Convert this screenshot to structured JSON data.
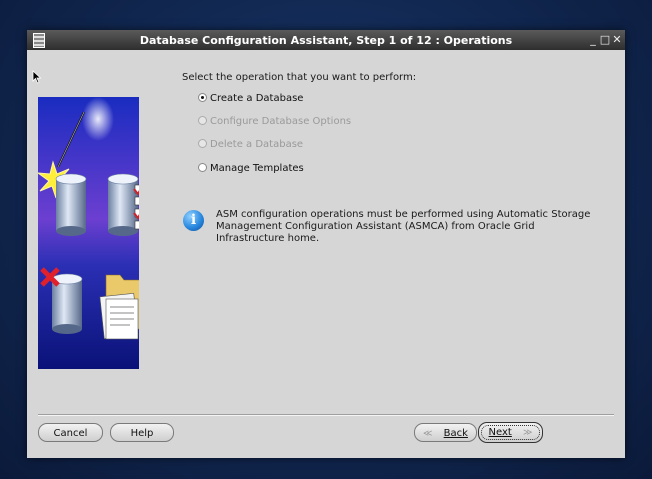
{
  "window": {
    "title": "Database Configuration Assistant, Step 1 of 12 : Operations",
    "controls": {
      "minimize": "_",
      "maximize": "□",
      "close": "✕"
    }
  },
  "main": {
    "prompt": "Select the operation that you want to perform:",
    "options": [
      {
        "label": "Create a Database",
        "selected": true,
        "enabled": true
      },
      {
        "label": "Configure Database Options",
        "selected": false,
        "enabled": false
      },
      {
        "label": "Delete a Database",
        "selected": false,
        "enabled": false
      },
      {
        "label": "Manage Templates",
        "selected": false,
        "enabled": true
      }
    ],
    "info_message": "ASM configuration operations must be performed using Automatic Storage Management Configuration Assistant (ASMCA) from Oracle Grid Infrastructure home.",
    "info_icon": "i"
  },
  "footer": {
    "cancel_label": "Cancel",
    "help_label": "Help",
    "back_label": "Back",
    "next_label": "Next",
    "back_arrow": "≪",
    "next_arrow": "≫"
  },
  "colors": {
    "window_bg": "#d6d6d6",
    "titlebar": "#3a3a3a",
    "banner_blue": "#1c2fb0",
    "info_blue": "#2b8ae0"
  }
}
